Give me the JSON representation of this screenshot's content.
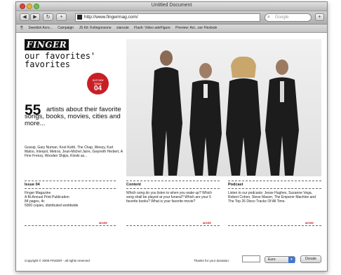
{
  "window": {
    "title": "Untitled Document"
  },
  "toolbar": {
    "back": "◀",
    "forward": "▶",
    "reload": "↻",
    "add": "+",
    "url": "http://www.fingermag.com/",
    "search_placeholder": "Google",
    "bookmark_icon": "+"
  },
  "bookmarks": [
    "Swedish Acro...",
    "Campaign",
    "JS Kit: Kolingonsone",
    "viaroute",
    "Flash: Video adeFigure",
    "Preview: Act...oor Flexbule"
  ],
  "site": {
    "logo": "FINGER",
    "tagline": "our favorites' favorites",
    "badge": {
      "line1": "out now",
      "line2": "issue",
      "line3": "04"
    },
    "big_number": "55",
    "headline": "artists about their favorite songs, books, movies, cities and more...",
    "names": "Gossip, Gary Numan, Kool Keith, The Chap, Weezy, Kurt Maloo, Interpol, Metros, Jean-Michel Jarre, Gwyneth Herbert, A Fine Frenzy, Wooden Shjips, Kinski as..."
  },
  "columns": [
    {
      "title": "Issue 04",
      "text": "Finger Magazine\nA Bi-Annual Print Publication\n84 pages, 4c\n5000 copies, distributed worldwide",
      "more": "MORE"
    },
    {
      "title": "Content",
      "text": "Which song do you listen to when you wake up? Which song shall be played at your funeral? Which are your 5 favorite books? What is your favorite movie?",
      "more": "MORE"
    },
    {
      "title": "Podcast",
      "text": "Listen to our podcasts: Jesse Hughes, Suzanne Vega, Robert Cohen, Steve Mason, The Emperor Machine and The Top 26 Disco Tracks Of All Time.",
      "more": "MORE"
    }
  ],
  "footer": {
    "copyright": "Copyright © 2008 FINGER - all rights reserved",
    "donation_label": "Thanks for your donation:",
    "currency": "Euro",
    "donate_button": "Donate"
  }
}
